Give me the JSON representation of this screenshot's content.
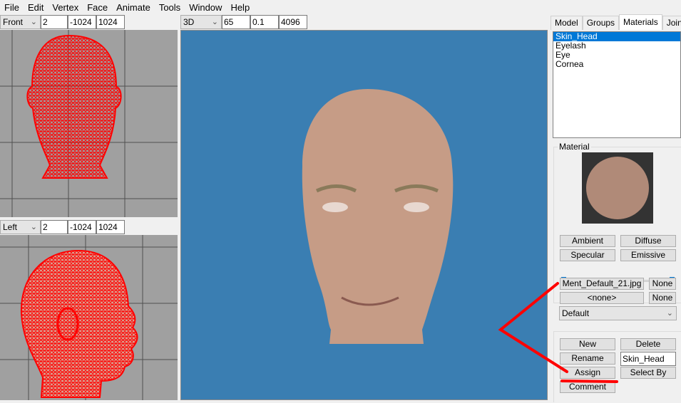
{
  "menu": [
    "File",
    "Edit",
    "Vertex",
    "Face",
    "Animate",
    "Tools",
    "Window",
    "Help"
  ],
  "menu_underline": [
    "F",
    "E",
    "V",
    "c",
    "A",
    "T",
    "W",
    "H"
  ],
  "front_toolbar": {
    "view": "Front",
    "v1": "2",
    "v2": "-1024",
    "v3": "1024"
  },
  "left_toolbar": {
    "view": "Left",
    "v1": "2",
    "v2": "-1024",
    "v3": "1024"
  },
  "view3d_toolbar": {
    "view": "3D",
    "v1": "65",
    "v2": "0.1",
    "v3": "4096"
  },
  "tabs": [
    "Model",
    "Groups",
    "Materials",
    "Joints"
  ],
  "active_tab": "Materials",
  "materials": [
    "Skin_Head",
    "Eyelash",
    "Eye",
    "Cornea"
  ],
  "selected_material": "Skin_Head",
  "material_group_label": "Material",
  "buttons": {
    "ambient": "Ambient",
    "diffuse": "Diffuse",
    "specular": "Specular",
    "emissive": "Emissive",
    "texture": "Ment_Default_21.jpg",
    "none1": "None",
    "alpha": "<none>",
    "none2": "None",
    "new": "New",
    "delete": "Delete",
    "rename": "Rename",
    "assign": "Assign",
    "select_by": "Select By",
    "comment": "Comment"
  },
  "sliders": {
    "shininess": 0,
    "transparency": 1
  },
  "mode_select": "Default",
  "name_field": "Skin_Head",
  "colors": {
    "viewport_bg": "#a0a0a0",
    "view3d_bg": "#3a7eb2",
    "wireframe": "#ff0000",
    "selection": "#0078d7",
    "annotation": "#ff0000"
  }
}
